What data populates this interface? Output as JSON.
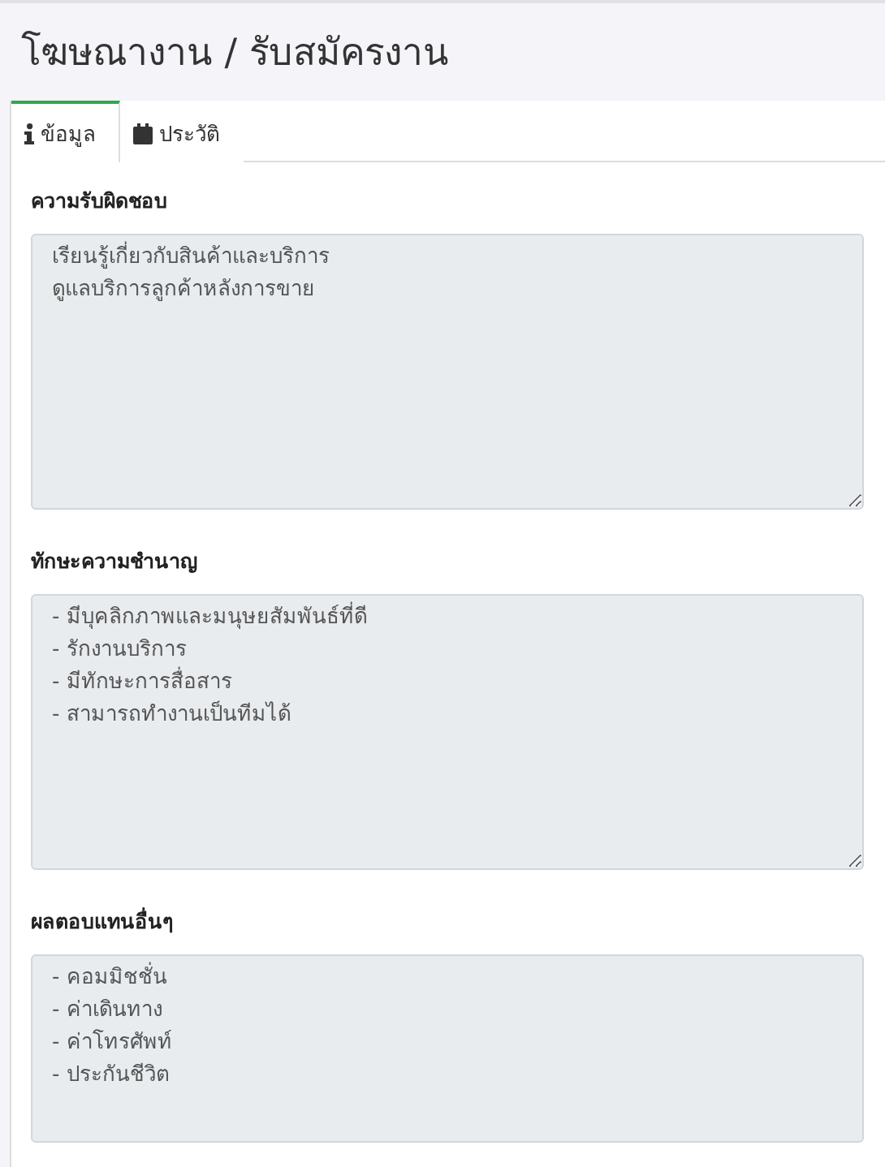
{
  "page_title": "โฆษณางาน / รับสมัครงาน",
  "tabs": [
    {
      "label": "ข้อมูล",
      "kind": "info",
      "selected": true
    },
    {
      "label": "ประวัติ",
      "kind": "calendar",
      "selected": false
    }
  ],
  "sections": [
    {
      "label": "ความรับผิดชอบ",
      "lines": [
        "เรียนรู้เกี่ยวกับสินค้าและบริการ",
        "ดูแลบริการลูกค้าหลังการขาย"
      ]
    },
    {
      "label": "ทักษะความชำนาญ",
      "lines": [
        "- มีบุคลิกภาพและมนุษยสัมพันธ์ที่ดี",
        "- รักงานบริการ",
        "- มีทักษะการสื่อสาร",
        "- สามารถทำงานเป็นทีมได้"
      ]
    },
    {
      "label": "ผลตอบแทนอื่นๆ",
      "lines": [
        "- คอมมิชชั่น",
        "- ค่าเดินทาง",
        "- ค่าโทรศัพท์",
        "- ประกันชีวิต"
      ]
    }
  ]
}
